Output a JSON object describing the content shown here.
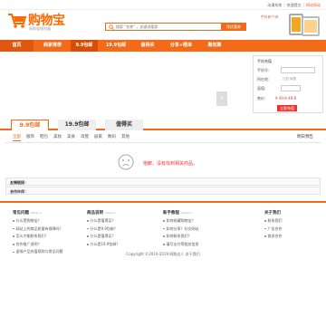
{
  "topbar": {
    "links": [
      "动漫系统",
      "快速提交",
      "网站网站"
    ]
  },
  "header": {
    "logo_title": "购物宝",
    "logo_sub": "网购省钱利器",
    "search_placeholder": "搜索 \"名称\" ，关键词搜索",
    "search_button": "找优惠券",
    "promo_text": "手机客户端"
  },
  "nav": {
    "items": [
      "首页",
      "商家推荐",
      "9.9包邮",
      "19.9包邮",
      "值得买",
      "分享+晒单",
      "聚划算"
    ]
  },
  "recharge": {
    "title": "手机充值",
    "phone_label": "手机号:",
    "area_label": "所在地:",
    "area_value": "江西 南昌",
    "amount_label": "面值:",
    "price_label": "售价:",
    "price_value": "¥ 49.9-49.8",
    "pay_button": "立即充值"
  },
  "tabs": [
    "9.9包邮",
    "19.9包邮",
    "值得买"
  ],
  "filters": {
    "items": [
      "全部",
      "服饰",
      "鞋包",
      "美妆",
      "美食",
      "母婴",
      "居家",
      "数码",
      "其他"
    ],
    "active_index": 0,
    "tomorrow": "明日预告"
  },
  "empty": {
    "message": "抱歉，没有找到相关商品。"
  },
  "friend_links": {
    "label": "友情链接："
  },
  "partners": {
    "label": "合作伙伴："
  },
  "footer": {
    "columns": [
      {
        "title": "常见问题",
        "more": "more>>",
        "items": [
          "什么是购物宝？",
          "网站上的商品质量有保障吗？",
          "怎么才能联系我们？",
          "合作推广说明？",
          "虚拟产品充值规则与常见问题"
        ]
      },
      {
        "title": "商品说明",
        "more": "more>>",
        "items": [
          "什么是值得买？",
          "什么是9.9包邮？",
          "什么是值得买？",
          "什么是19.9包邮？"
        ]
      },
      {
        "title": "新手教程",
        "more": "more>>",
        "items": [
          "如何收藏购物宝？",
          "如何分享？社交网站",
          "如何联系我们？",
          "填写支付等相关信息"
        ]
      },
      {
        "title": "关于我们",
        "more": "",
        "items": [
          "联系我们",
          "广告合作",
          "商务合作"
        ]
      }
    ],
    "copyright": "Copyright ©2010-2019 网购达人 关于我们"
  }
}
